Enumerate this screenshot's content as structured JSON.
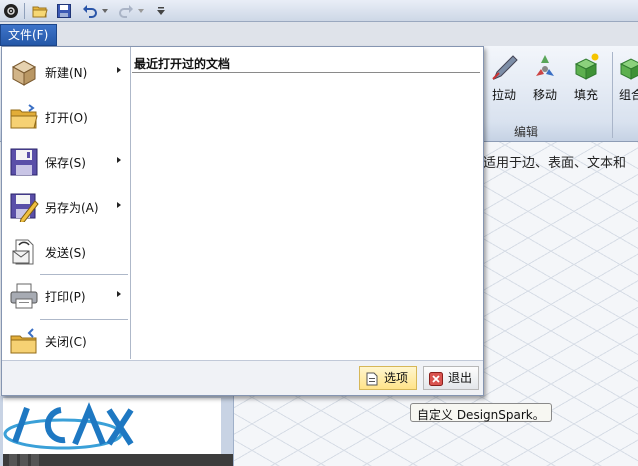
{
  "file_menu": {
    "tab_label": "文件(F)",
    "commands": [
      {
        "label": "新建(N)",
        "icon": "new-box-icon",
        "submenu": true
      },
      {
        "label": "打开(O)",
        "icon": "open-folder-icon",
        "submenu": false
      },
      {
        "label": "保存(S)",
        "icon": "save-disk-icon",
        "submenu": true
      },
      {
        "label": "另存为(A)",
        "icon": "save-as-icon",
        "submenu": true
      },
      {
        "label": "发送(S)",
        "icon": "send-mail-icon",
        "submenu": false
      },
      {
        "label": "打印(P)",
        "icon": "printer-icon",
        "submenu": true
      },
      {
        "label": "关闭(C)",
        "icon": "close-folder-icon",
        "submenu": false
      }
    ],
    "recent_title": "最近打开过的文档",
    "recent_docs": [],
    "options_label": "选项",
    "exit_label": "退出"
  },
  "ribbon": {
    "tools": [
      {
        "label": "拉动",
        "icon": "pull-icon"
      },
      {
        "label": "移动",
        "icon": "move-icon"
      },
      {
        "label": "填充",
        "icon": "fill-icon"
      },
      {
        "label": "组合",
        "icon": "combine-icon"
      }
    ],
    "group_label": "编辑"
  },
  "canvas": {
    "hint": "适用于边、表面、文本和",
    "tooltip": "自定义 DesignSpark。"
  },
  "colors": {
    "file_tab": "#2f63b8",
    "options_button": "#ffe389"
  }
}
